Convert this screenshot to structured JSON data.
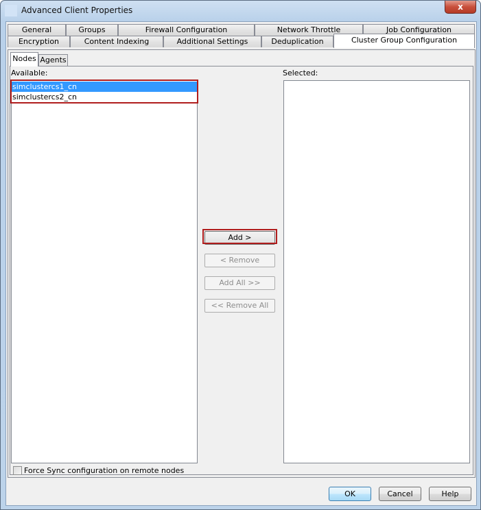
{
  "window": {
    "title": "Advanced Client Properties",
    "close_label": "x"
  },
  "tabs_row1": [
    "General",
    "Groups",
    "Firewall Configuration",
    "Network Throttle",
    "Job Configuration"
  ],
  "tabs_row2": [
    "Encryption",
    "Content Indexing",
    "Additional Settings",
    "Deduplication",
    "Cluster Group Configuration"
  ],
  "active_tab": "Cluster Group Configuration",
  "subtabs": [
    "Nodes",
    "Agents"
  ],
  "active_subtab": "Nodes",
  "available": {
    "label": "Available:",
    "items": [
      {
        "name": "simclustercs1_cn",
        "selected": true
      },
      {
        "name": "simclustercs2_cn",
        "selected": false
      }
    ]
  },
  "selected": {
    "label": "Selected:",
    "items": []
  },
  "buttons": {
    "add": "Add >",
    "remove": "< Remove",
    "add_all": "Add All >>",
    "remove_all": "<< Remove All"
  },
  "force_sync": {
    "label": "Force Sync configuration on remote nodes",
    "checked": false
  },
  "footer": {
    "ok": "OK",
    "cancel": "Cancel",
    "help": "Help"
  },
  "highlight_color": "#b01c1c",
  "selection_color": "#3399ff"
}
